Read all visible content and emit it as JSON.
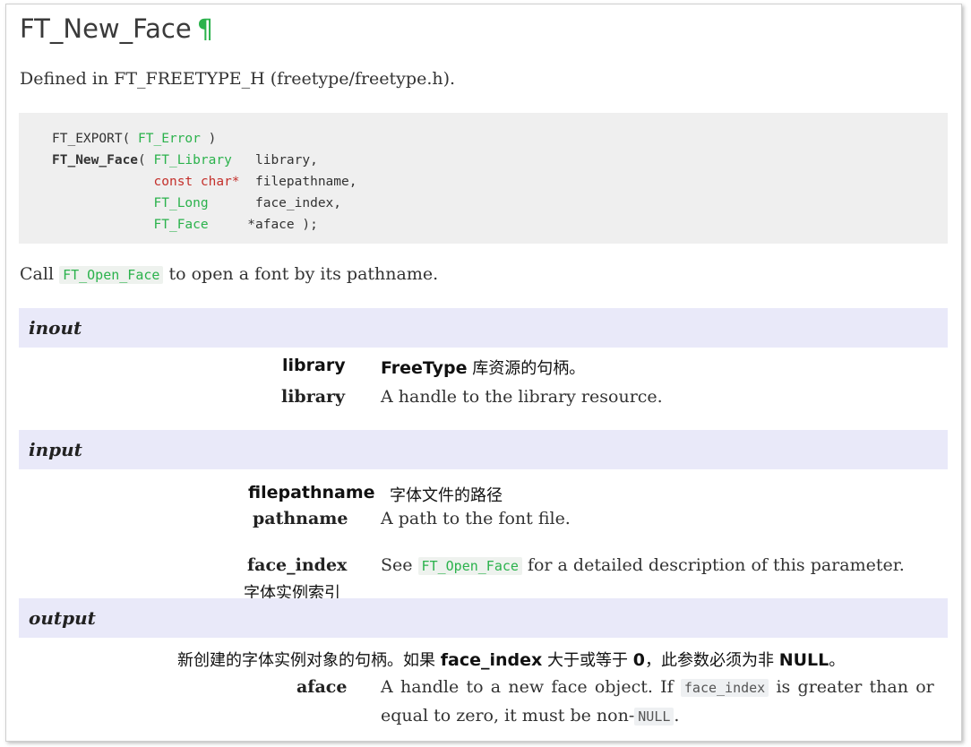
{
  "heading": {
    "title": "FT_New_Face",
    "anchor": "¶"
  },
  "defined_in": "Defined in FT_FREETYPE_H (freetype/freetype.h).",
  "signature": {
    "line1_macro": "FT_EXPORT( ",
    "line1_type": "FT_Error",
    "line1_end": " )",
    "func_name": "FT_New_Face",
    "open_paren": "( ",
    "params": [
      {
        "type": "FT_Library",
        "type_color": "green",
        "name": "   library,"
      },
      {
        "type": "const char*",
        "type_color": "red",
        "name": "  filepathname,"
      },
      {
        "type": "FT_Long",
        "type_color": "green",
        "name": "      face_index,"
      },
      {
        "type": "FT_Face",
        "type_color": "green",
        "name": "     *aface );"
      }
    ]
  },
  "summary": {
    "before": "Call ",
    "code": "FT_Open_Face",
    "after": " to open a font by its pathname."
  },
  "sections": {
    "inout": "inout",
    "input": "input",
    "output": "output"
  },
  "params": {
    "library_cn_name": "library",
    "library_cn_desc_prefix": "FreeType",
    "library_cn_desc": " 库资源的句柄。",
    "library_name": "library",
    "library_desc": "A handle to the library resource.",
    "filepathname_cn_name": "filepathname",
    "filepathname_cn_desc": "字体文件的路径",
    "pathname_name": "pathname",
    "pathname_desc": "A path to the font file.",
    "face_index_name": "face_index",
    "face_index_cn": "字体实例索引",
    "face_index_desc_before": "See ",
    "face_index_desc_code": "FT_Open_Face",
    "face_index_desc_after": " for a detailed description of this parameter.",
    "aface_cn_1": "新创建的字体实例对象的句柄。如果 ",
    "aface_cn_b1": "face_index",
    "aface_cn_2": " 大于或等于 ",
    "aface_cn_b2": "0",
    "aface_cn_3": "，此参数必须为非 ",
    "aface_cn_b3": "NULL",
    "aface_cn_4": "。",
    "aface_name": "aface",
    "aface_desc_1": "A handle to a new face object. If ",
    "aface_desc_code": "face_index",
    "aface_desc_2": " is greater than or",
    "aface_desc_3": "equal to zero, it must be non-",
    "aface_desc_code2": "NULL",
    "aface_desc_4": "."
  }
}
